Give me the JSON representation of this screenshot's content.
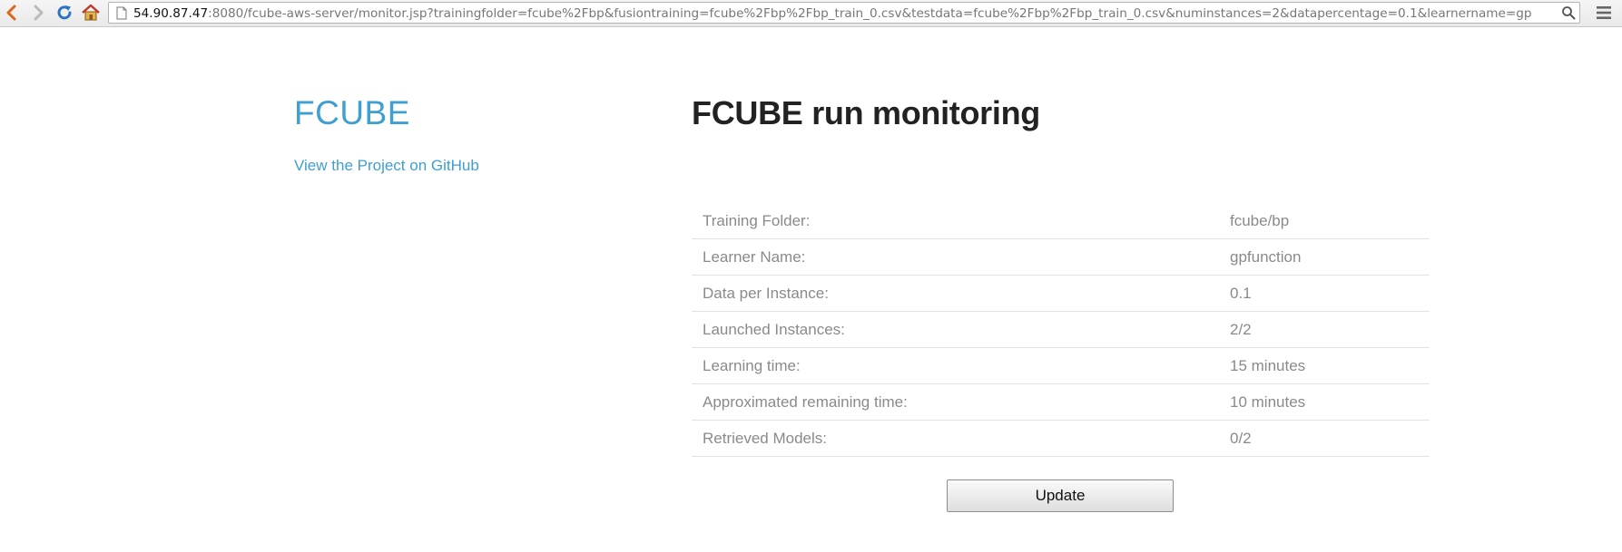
{
  "browser": {
    "url_host": "54.90.87.47",
    "url_rest": ":8080/fcube-aws-server/monitor.jsp?trainingfolder=fcube%2Fbp&fusiontraining=fcube%2Fbp%2Fbp_train_0.csv&testdata=fcube%2Fbp%2Fbp_train_0.csv&numinstances=2&datapercentage=0.1&learnername=gp",
    "icons": [
      "back-arrow-icon",
      "forward-arrow-icon",
      "reload-icon",
      "home-icon",
      "page-icon",
      "zoom-icon",
      "menu-icon"
    ]
  },
  "sidebar": {
    "brand": "FCUBE",
    "github_link": "View the Project on GitHub"
  },
  "main": {
    "title": "FCUBE run monitoring",
    "rows": [
      {
        "label": "Training Folder:",
        "value": "fcube/bp"
      },
      {
        "label": "Learner Name:",
        "value": "gpfunction"
      },
      {
        "label": "Data per Instance:",
        "value": "0.1"
      },
      {
        "label": "Launched Instances:",
        "value": "2/2"
      },
      {
        "label": "Learning time:",
        "value": "15 minutes"
      },
      {
        "label": "Approximated remaining time:",
        "value": "10 minutes"
      },
      {
        "label": "Retrieved Models:",
        "value": "0/2"
      }
    ],
    "update_button": "Update"
  },
  "colors": {
    "link": "#3e9fd0",
    "title": "#222222",
    "table_text": "#8a8a8a",
    "nav_back": "#d9661a",
    "reload": "#2f74c0",
    "home": "#c0392b"
  }
}
